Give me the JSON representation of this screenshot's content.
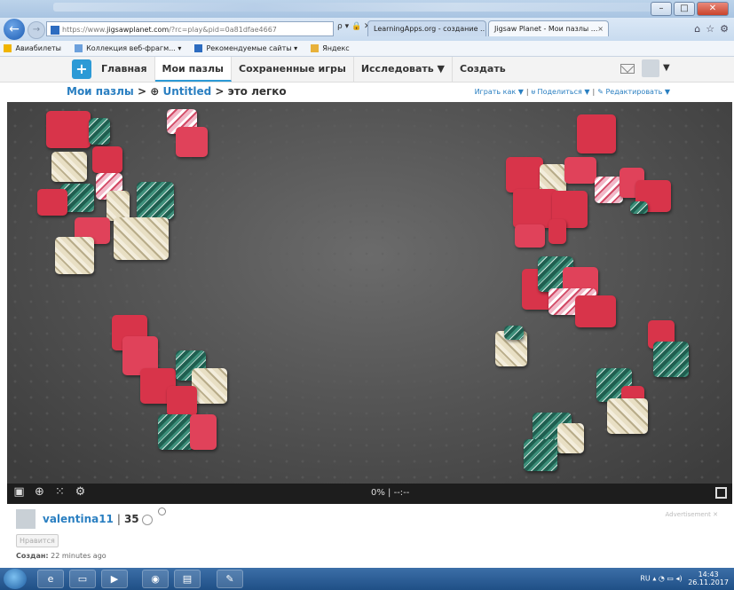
{
  "browser": {
    "url_prefix": "https://www.",
    "url_domain": "jigsawplanet.com",
    "url_rest": "/?rc=play&pid=0a81dfae4667",
    "addr_tools": "ρ ▾ 🔒 ✕",
    "tabs": [
      {
        "label": "LearningApps.org - создание ..."
      },
      {
        "label": "Jigsaw Planet - Мои пазлы ...",
        "active": true
      }
    ],
    "favorites": [
      "Авиабилеты",
      "Коллекция веб-фрагм... ▾",
      "Рекомендуемые сайты ▾",
      "Яндекс"
    ]
  },
  "site": {
    "menu": [
      "Главная",
      "Мои пазлы",
      "Сохраненные игры",
      "Исследовать ▼",
      "Создать"
    ],
    "active_menu_index": 1,
    "breadcrumb": {
      "root": "Мои пазлы",
      "sep1": " > ",
      "globe": "⊕",
      "folder": "Untitled",
      "sep2": " > ",
      "puzzle": "это легко"
    },
    "actions": {
      "play_as": "Играть как ▼",
      "share": "Поделиться ▼",
      "edit": "Редактировать ▼"
    }
  },
  "board": {
    "progress_label": "0% | --:--",
    "progress_percent": 0
  },
  "owner": {
    "name": "valentina11",
    "separator": "|",
    "score": "35",
    "like_label": "Нравится",
    "created_label": "Создан:",
    "created_value": " 22 minutes ago",
    "ad_label": "Advertisement ✕"
  },
  "taskbar": {
    "lang": "RU",
    "time": "14:43",
    "date": "26.11.2017"
  },
  "colors": {
    "accent": "#2a7fc1",
    "piece_red": "#d8344a",
    "piece_green": "#1f5f50",
    "board_bg": "#555555"
  }
}
